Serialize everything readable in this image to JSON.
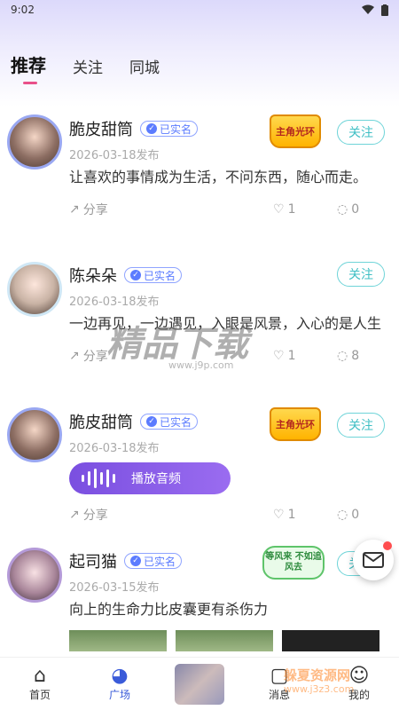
{
  "status_bar": {
    "time": "9:02"
  },
  "tabs": [
    {
      "label": "推荐",
      "active": true
    },
    {
      "label": "关注",
      "active": false
    },
    {
      "label": "同城",
      "active": false
    }
  ],
  "verified_label": "已实名",
  "follow_label": "关注",
  "share_label": "分享",
  "posts": [
    {
      "name": "脆皮甜筒",
      "date": "2026-03-18发布",
      "content": "让喜欢的事情成为生活，不问东西，随心而走。",
      "likes": "1",
      "comments": "0",
      "medal": "主角光环"
    },
    {
      "name": "陈朵朵",
      "date": "2026-03-18发布",
      "content": "一边再见，一边遇见，入眼是风景，入心的是人生",
      "likes": "1",
      "comments": "8"
    },
    {
      "name": "脆皮甜筒",
      "date": "2026-03-18发布",
      "audio_label": "播放音频",
      "likes": "1",
      "comments": "0",
      "medal": "主角光环"
    },
    {
      "name": "起司猫",
      "date": "2026-03-15发布",
      "content": "向上的生命力比皮囊更有杀伤力",
      "medal": "等风来 不如追风去"
    }
  ],
  "bottom_nav": [
    {
      "label": "首页",
      "icon": "home-icon"
    },
    {
      "label": "广场",
      "icon": "square-icon",
      "active": true
    },
    {
      "label": "",
      "icon": "center-image"
    },
    {
      "label": "消息",
      "icon": "message-icon"
    },
    {
      "label": "我的",
      "icon": "profile-icon"
    }
  ],
  "watermarks": {
    "main": "精品下载",
    "main_url": "www.j9p.com",
    "corner": "躲夏资源网",
    "corner_url": "www.j3z3.com"
  },
  "colors": {
    "accent": "#e9508a",
    "follow": "#3fbfc4",
    "verified": "#5c7cff",
    "audio": "#7a4fe0"
  }
}
